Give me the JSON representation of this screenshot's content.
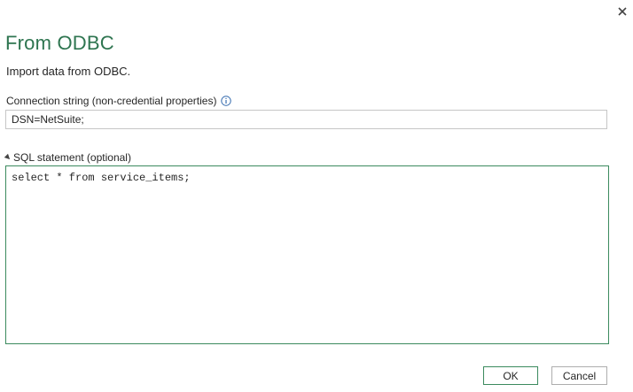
{
  "dialog": {
    "title": "From ODBC",
    "subtitle": "Import data from ODBC.",
    "close_icon": "close-icon"
  },
  "connection": {
    "label": "Connection string (non-credential properties)",
    "info_icon": "info-icon",
    "value": "DSN=NetSuite;"
  },
  "sql": {
    "label": "SQL statement (optional)",
    "expander_icon": "collapse-triangle-icon",
    "value": "select * from service_items;"
  },
  "buttons": {
    "ok_label": "OK",
    "cancel_label": "Cancel"
  },
  "colors": {
    "accent": "#2e7550",
    "focus_border": "#3b8a5e"
  }
}
